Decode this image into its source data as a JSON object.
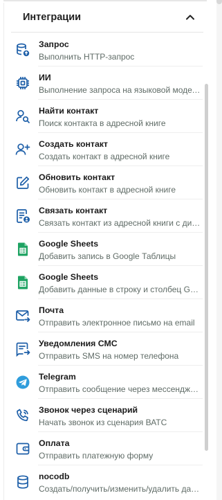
{
  "section": {
    "title": "Интеграции",
    "toggle_icon": "chevron-up-icon"
  },
  "colors": {
    "accent": "#1c5ea8",
    "sheets_green": "#1ea362",
    "telegram_blue": "#2f9ddc",
    "title_text": "#1b1b1b",
    "desc_text": "#5f6b66"
  },
  "items": [
    {
      "icon": "database-upload-icon",
      "title": "Запрос",
      "description": "Выполнить HTTP-запрос"
    },
    {
      "icon": "chip-icon",
      "title": "ИИ",
      "description": "Выполнение запроса на языковой модели"
    },
    {
      "icon": "person-search-icon",
      "title": "Найти контакт",
      "description": "Поиск контакта в адресной книге"
    },
    {
      "icon": "person-add-icon",
      "title": "Создать контакт",
      "description": "Создать контакт в адресной книге"
    },
    {
      "icon": "edit-icon",
      "title": "Обновить контакт",
      "description": "Обновить контакт в адресной книге"
    },
    {
      "icon": "contact-link-icon",
      "title": "Связать контакт",
      "description": "Связать контакт из адресной книги с диалогом"
    },
    {
      "icon": "google-sheets-icon",
      "title": "Google Sheets",
      "description": "Добавить запись в Google Таблицы"
    },
    {
      "icon": "google-sheets-icon",
      "title": "Google Sheets",
      "description": "Добавить данные в строку и столбец Google Таблицы"
    },
    {
      "icon": "mail-send-icon",
      "title": "Почта",
      "description": "Отправить электронное письмо на email"
    },
    {
      "icon": "sms-send-icon",
      "title": "Уведомления СМС",
      "description": "Отправить SMS на номер телефона"
    },
    {
      "icon": "telegram-icon",
      "title": "Telegram",
      "description": "Отправить сообщение через мессенджер Telegram"
    },
    {
      "icon": "phone-call-icon",
      "title": "Звонок через сценарий",
      "description": "Начать звонок из сценария ВАТС"
    },
    {
      "icon": "wallet-icon",
      "title": "Оплата",
      "description": "Отправить платежную форму"
    },
    {
      "icon": "database-icon",
      "title": "nocodb",
      "description": "Создать/получить/изменить/удалить данные"
    }
  ]
}
